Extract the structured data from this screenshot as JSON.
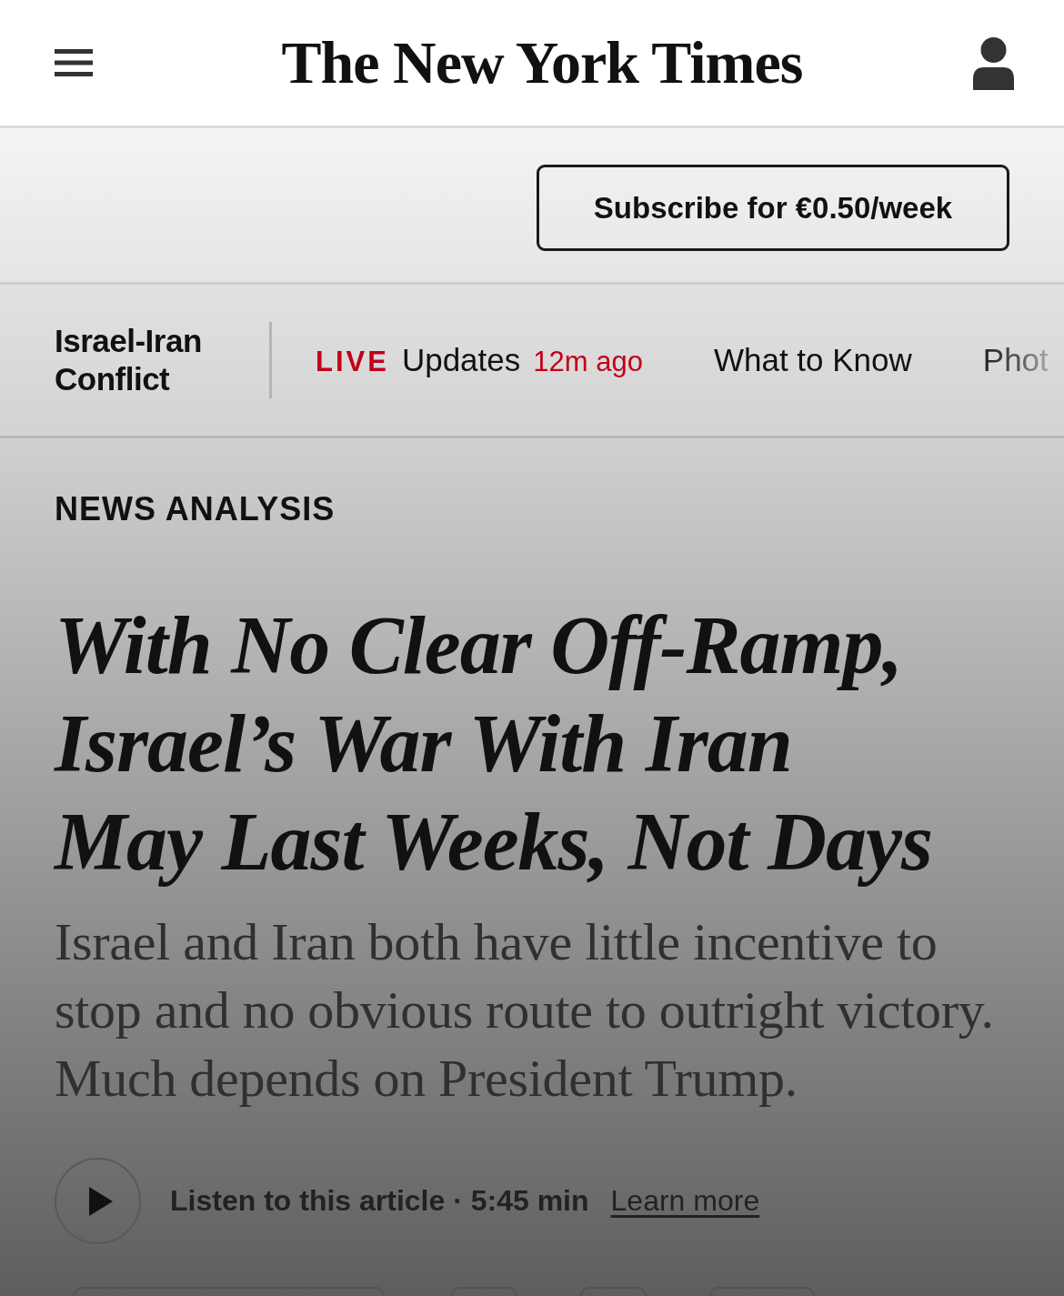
{
  "header": {
    "logo": "The New York Times"
  },
  "subscribe": {
    "label": "Subscribe for €0.50/week"
  },
  "nav": {
    "section": "Israel-Iran Conflict",
    "links": [
      {
        "kind": "live",
        "badge": "LIVE",
        "label": "Updates",
        "time": "12m ago"
      },
      {
        "kind": "plain",
        "label": "What to Know"
      },
      {
        "kind": "cut",
        "label": "Phot"
      }
    ]
  },
  "article": {
    "kicker": "NEWS ANALYSIS",
    "headline": "With No Clear Off-Ramp, Israel’s War With Iran May Last Weeks, Not Days",
    "summary": "Israel and Iran both have little incentive to stop and no obvious route to outright victory. Much depends on President Trump.",
    "audio": {
      "label": "Listen to this article · 5:45 min",
      "link": "Learn more"
    }
  },
  "bottom_buttons": [
    {
      "kind": "pill"
    },
    {
      "kind": "circle"
    },
    {
      "kind": "circle"
    },
    {
      "kind": "rounded"
    }
  ]
}
